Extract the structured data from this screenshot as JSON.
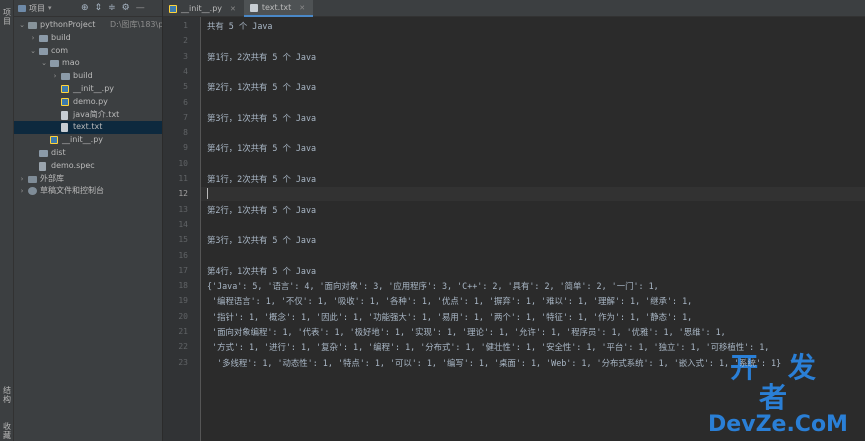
{
  "left_strip": {
    "project_tab": "项目",
    "structure_tab": "结构",
    "favorites_tab": "收藏"
  },
  "project_panel": {
    "title": "项目",
    "tree": [
      {
        "label": "pythonProject",
        "path": "D:\\图库\\183\\pyth",
        "depth": 0,
        "type": "project",
        "expanded": true
      },
      {
        "label": "build",
        "depth": 1,
        "type": "folder",
        "expanded": false
      },
      {
        "label": "com",
        "depth": 1,
        "type": "folder",
        "expanded": true
      },
      {
        "label": "mao",
        "depth": 2,
        "type": "folder",
        "expanded": true
      },
      {
        "label": "build",
        "depth": 3,
        "type": "folder",
        "expanded": false
      },
      {
        "label": "__init__.py",
        "depth": 3,
        "type": "py"
      },
      {
        "label": "demo.py",
        "depth": 3,
        "type": "py"
      },
      {
        "label": "java简介.txt",
        "depth": 3,
        "type": "txt"
      },
      {
        "label": "text.txt",
        "depth": 3,
        "type": "txt",
        "selected": true
      },
      {
        "label": "__init__.py",
        "depth": 2,
        "type": "py"
      },
      {
        "label": "dist",
        "depth": 1,
        "type": "folder"
      },
      {
        "label": "demo.spec",
        "depth": 1,
        "type": "spec"
      },
      {
        "label": "外部库",
        "depth": 0,
        "type": "lib",
        "expanded": false
      },
      {
        "label": "草稿文件和控制台",
        "depth": 0,
        "type": "scratch",
        "expanded": false
      }
    ]
  },
  "tabs": [
    {
      "label": "__init__.py",
      "icon": "python-file-icon",
      "active": false
    },
    {
      "label": "text.txt",
      "icon": "text-file-icon",
      "active": true
    }
  ],
  "editor": {
    "current_line": 12,
    "lines": [
      "共有 5 个 Java",
      "",
      "第1行，2次共有 5 个 Java",
      "",
      "第2行，1次共有 5 个 Java",
      "",
      "第3行，1次共有 5 个 Java",
      "",
      "第4行，1次共有 5 个 Java",
      "",
      "第1行，2次共有 5 个 Java",
      "",
      "第2行，1次共有 5 个 Java",
      "",
      "第3行，1次共有 5 个 Java",
      "",
      "第4行，1次共有 5 个 Java",
      "{'Java': 5, '语言': 4, '面向对象': 3, '应用程序': 3, 'C++': 2, '具有': 2, '简单': 2, '一门': 1,",
      " '编程语言': 1, '不仅': 1, '吸收': 1, '各种': 1, '优点': 1, '摒弃': 1, '难以': 1, '理解': 1, '继承': 1,",
      " '指针': 1, '概念': 1, '因此': 1, '功能强大': 1, '易用': 1, '两个': 1, '特征': 1, '作为': 1, '静态': 1,",
      " '面向对象编程': 1, '代表': 1, '极好地': 1, '实现': 1, '理论': 1, '允许': 1, '程序员': 1, '优雅': 1, '思维': 1,",
      " '方式': 1, '进行': 1, '复杂': 1, '编程': 1, '分布式': 1, '健壮性': 1, '安全性': 1, '平台': 1, '独立': 1, '可移植性': 1,",
      "  '多线程': 1, '动态性': 1, '特点': 1, '可以': 1, '编写': 1, '桌面': 1, 'Web': 1, '分布式系统': 1, '嵌入式': 1, '系统': 1}"
    ]
  },
  "watermark": {
    "line1": "开 发 者",
    "line2": "DevZe.CoM"
  }
}
